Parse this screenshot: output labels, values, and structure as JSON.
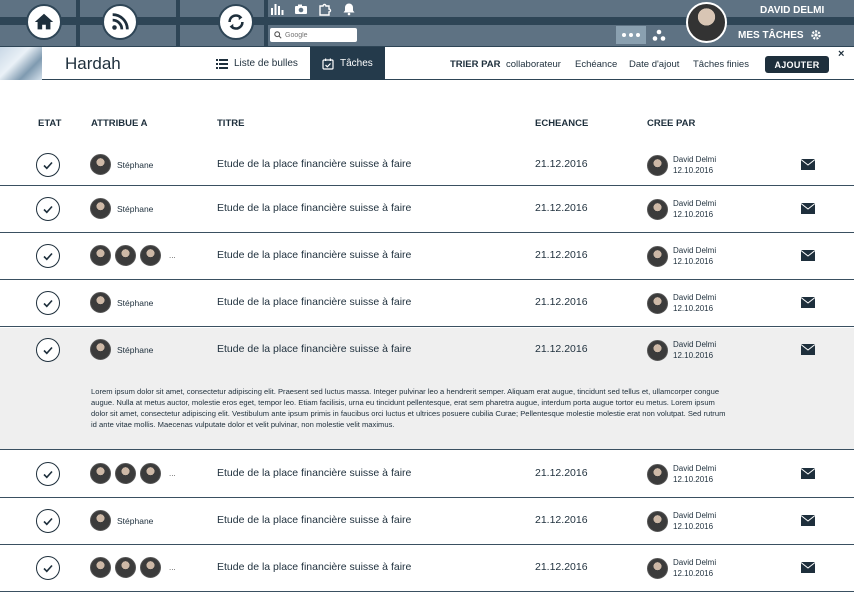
{
  "topbar": {
    "search_placeholder": "Google",
    "user_name": "DAVID DELMI",
    "mes_taches": "MES TÂCHES"
  },
  "subbar": {
    "app_title": "Hardah",
    "tabs": [
      {
        "label": "Liste de bulles"
      },
      {
        "label": "Tâches"
      }
    ],
    "sort_label": "TRIER PAR",
    "sort_options": [
      "collaborateur",
      "Echéance",
      "Date d'ajout",
      "Tâches finies"
    ],
    "add_button": "AJOUTER",
    "close": "×"
  },
  "table": {
    "columns": [
      "ETAT",
      "ATTRIBUE A",
      "TITRE",
      "ECHEANCE",
      "CREE PAR"
    ],
    "rows": [
      {
        "assignee": "Stéphane",
        "multi": false,
        "title": "Etude de la place financière suisse à faire",
        "due": "21.12.2016",
        "creator": "David Delmi",
        "created": "12.10.2016"
      },
      {
        "assignee": "Stéphane",
        "multi": false,
        "title": "Etude de la place financière suisse à faire",
        "due": "21.12.2016",
        "creator": "David Delmi",
        "created": "12.10.2016"
      },
      {
        "assignee": "...",
        "multi": true,
        "title": "Etude de la place financière suisse à faire",
        "due": "21.12.2016",
        "creator": "David Delmi",
        "created": "12.10.2016"
      },
      {
        "assignee": "Stéphane",
        "multi": false,
        "title": "Etude de la place financière suisse à faire",
        "due": "21.12.2016",
        "creator": "David Delmi",
        "created": "12.10.2016"
      },
      {
        "assignee": "Stéphane",
        "multi": false,
        "title": "Etude de la place financière suisse à faire",
        "due": "21.12.2016",
        "creator": "David Delmi",
        "created": "12.10.2016",
        "description": "Lorem ipsum dolor sit amet, consectetur adipiscing elit. Praesent sed luctus massa. Integer pulvinar leo a hendrerit semper. Aliquam erat augue, tincidunt sed tellus et, ullamcorper congue augue. Nulla at metus auctor, molestie eros eget, tempor leo. Etiam facilisis, urna eu tincidunt pellentesque, erat sem pharetra augue, interdum porta augue tortor eu metus. Lorem ipsum dolor sit amet, consectetur adipiscing elit. Vestibulum ante ipsum primis in faucibus orci luctus et ultrices posuere cubilia Curae; Pellentesque molestie molestie erat non volutpat. Sed rutrum id ante vitae mollis. Maecenas vulputate dolor et velit pulvinar, non molestie velit maximus."
      },
      {
        "assignee": "...",
        "multi": true,
        "title": "Etude de la place financière suisse à faire",
        "due": "21.12.2016",
        "creator": "David Delmi",
        "created": "12.10.2016"
      },
      {
        "assignee": "Stéphane",
        "multi": false,
        "title": "Etude de la place financière suisse à faire",
        "due": "21.12.2016",
        "creator": "David Delmi",
        "created": "12.10.2016"
      },
      {
        "assignee": "...",
        "multi": true,
        "title": "Etude de la place financière suisse à faire",
        "due": "21.12.2016",
        "creator": "David Delmi",
        "created": "12.10.2016"
      }
    ]
  },
  "colors": {
    "primary": "#1e2f3c",
    "topbar": "#5e7283",
    "stripe": "#2e4556",
    "expanded": "#efefef"
  }
}
